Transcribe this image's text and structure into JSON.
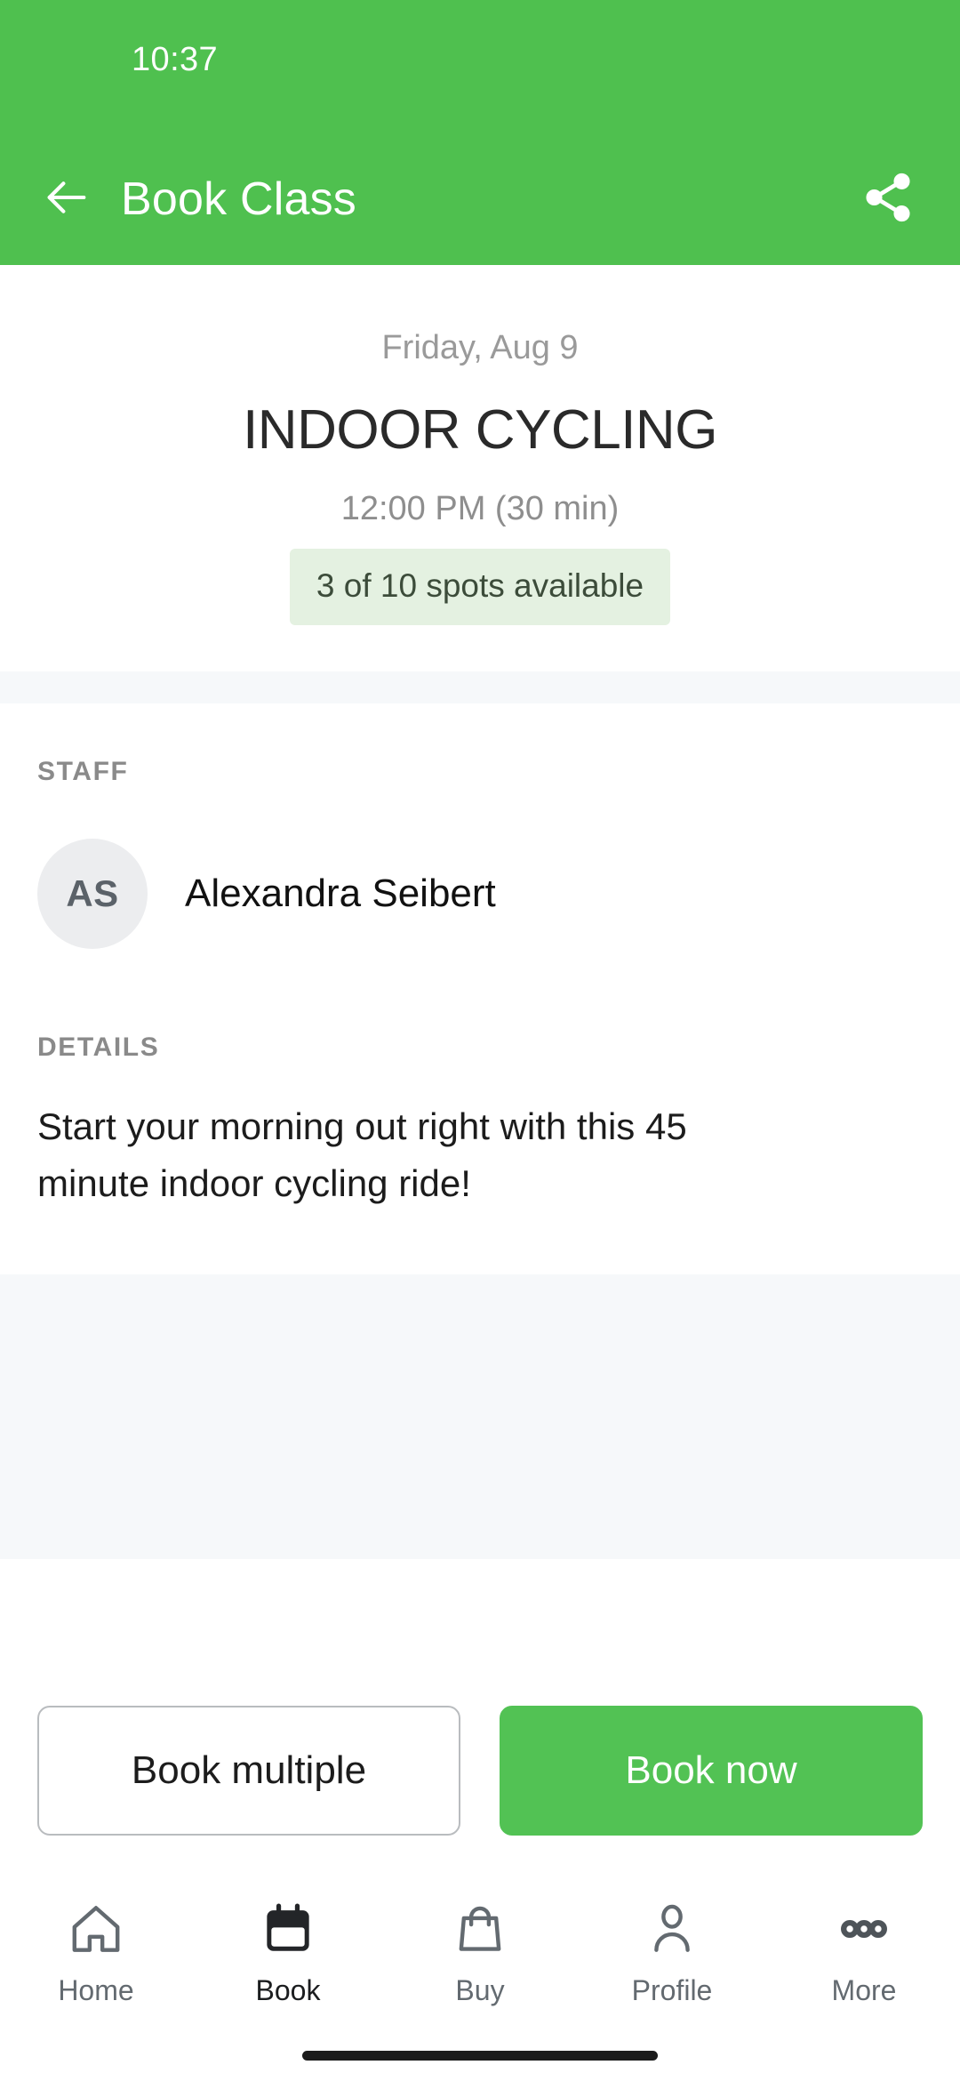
{
  "status_bar": {
    "time": "10:37"
  },
  "app_bar": {
    "title": "Book Class",
    "back_icon": "arrow-left-icon",
    "share_icon": "share-icon"
  },
  "class": {
    "date": "Friday, Aug 9",
    "name": "INDOOR CYCLING",
    "time": "12:00 PM (30 min)",
    "availability": "3 of 10 spots available"
  },
  "staff_section": {
    "label": "STAFF",
    "avatar_initials": "AS",
    "name": "Alexandra Seibert"
  },
  "details_section": {
    "label": "DETAILS",
    "text": "Start your morning out right with this 45 minute indoor cycling ride!"
  },
  "actions": {
    "secondary_label": "Book multiple",
    "primary_label": "Book now"
  },
  "bottom_nav": {
    "items": [
      {
        "label": "Home",
        "icon": "home-icon",
        "active": false
      },
      {
        "label": "Book",
        "icon": "calendar-icon",
        "active": true
      },
      {
        "label": "Buy",
        "icon": "shopping-bag-icon",
        "active": false
      },
      {
        "label": "Profile",
        "icon": "person-icon",
        "active": false
      },
      {
        "label": "More",
        "icon": "ellipsis-icon",
        "active": false
      }
    ]
  },
  "colors": {
    "brand_green": "#4fc04f",
    "button_green": "#52c254",
    "badge_bg": "#e4f1e1",
    "badge_text": "#3c4c3a",
    "band_bg": "#f6f8fa",
    "avatar_bg": "#ecedef"
  }
}
